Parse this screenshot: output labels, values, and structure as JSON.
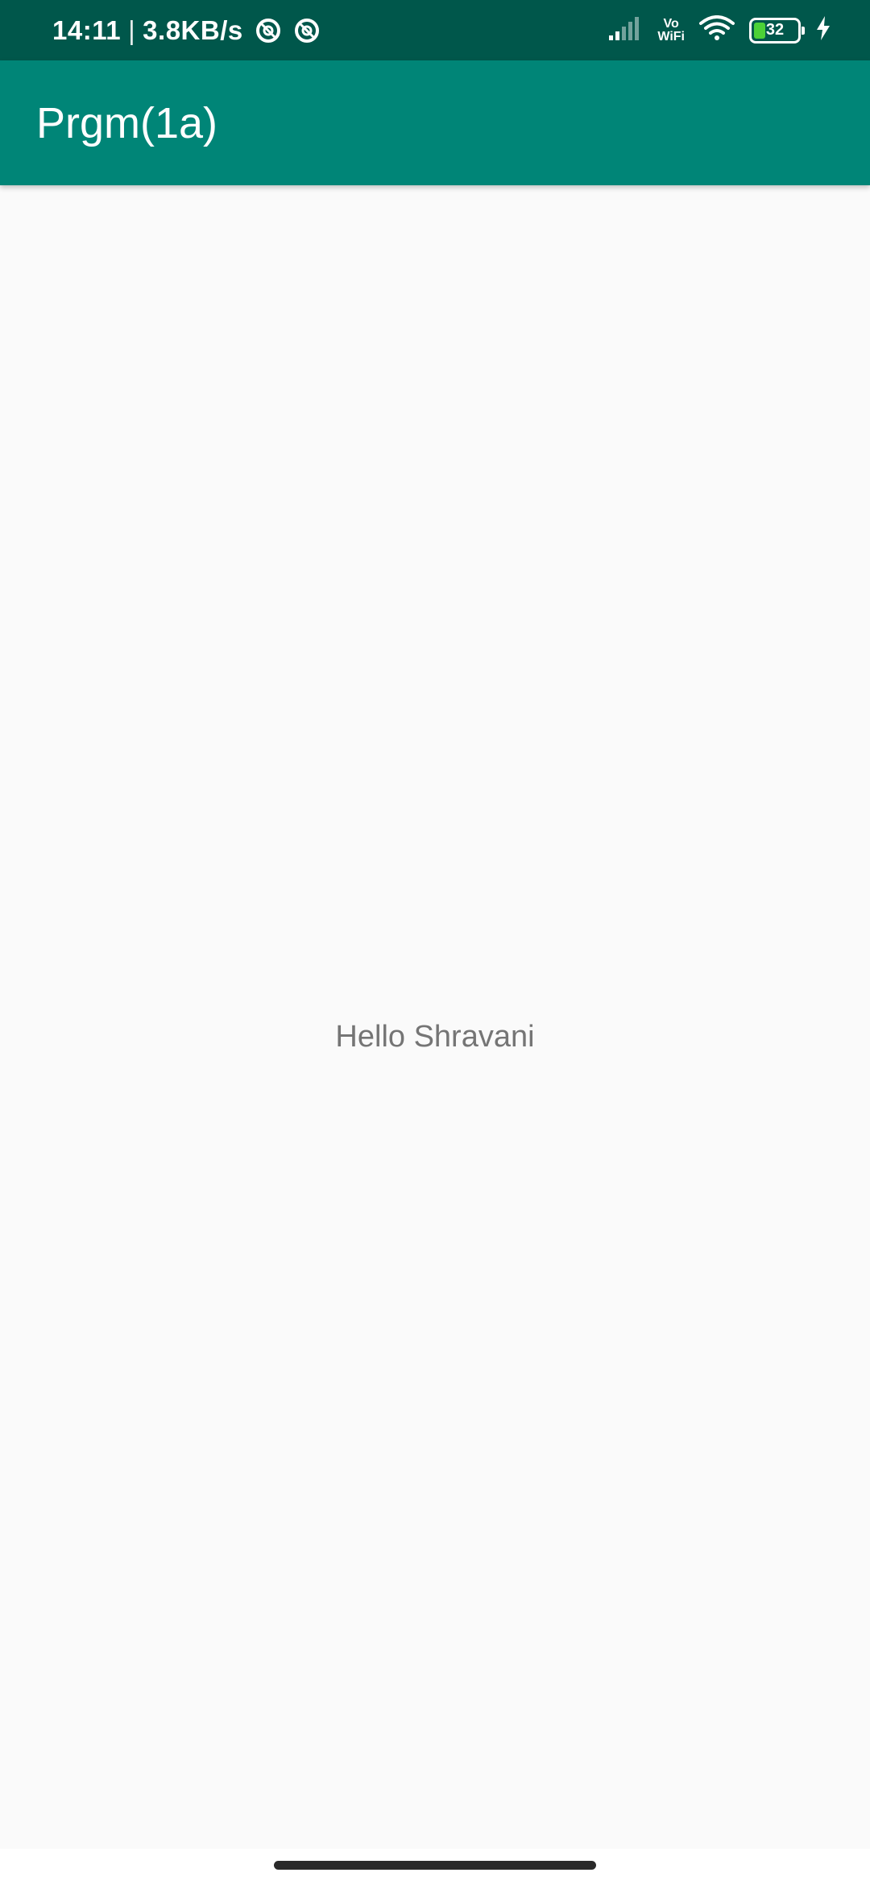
{
  "status_bar": {
    "time": "14:11",
    "separator": "|",
    "network_speed": "3.8KB/s",
    "vowifi_top": "Vo",
    "vowifi_bottom": "WiFi",
    "battery_level": "32",
    "icons": [
      "app-notification-icon",
      "app-notification-icon",
      "cell-signal-icon",
      "vowifi-icon",
      "wifi-icon",
      "battery-icon",
      "charging-icon"
    ]
  },
  "app_bar": {
    "title": "Prgm(1a)",
    "color": "#008577"
  },
  "main": {
    "message": "Hello Shravani"
  },
  "colors": {
    "status_bar": "#00574b",
    "app_bar": "#008577",
    "background": "#fafafa",
    "text": "#757575"
  }
}
